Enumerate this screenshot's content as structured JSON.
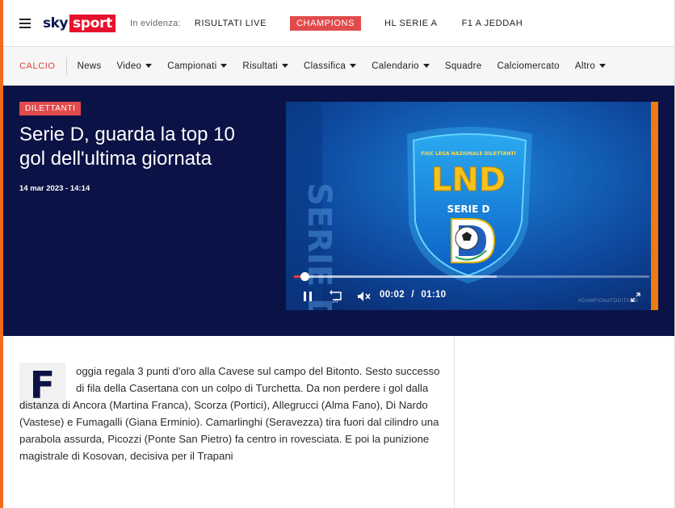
{
  "header": {
    "logo_sky": "sky",
    "logo_sport": "sport",
    "in_evidenza_label": "In evidenza:",
    "links": [
      "RISULTATI LIVE",
      "CHAMPIONS",
      "HL SERIE A",
      "F1 A JEDDAH"
    ]
  },
  "subnav": {
    "section": "CALCIO",
    "items": [
      {
        "label": "News",
        "dropdown": false
      },
      {
        "label": "Video",
        "dropdown": true
      },
      {
        "label": "Campionati",
        "dropdown": true
      },
      {
        "label": "Risultati",
        "dropdown": true
      },
      {
        "label": "Classifica",
        "dropdown": true
      },
      {
        "label": "Calendario",
        "dropdown": true
      },
      {
        "label": "Squadre",
        "dropdown": false
      },
      {
        "label": "Calciomercato",
        "dropdown": false
      },
      {
        "label": "Altro",
        "dropdown": true
      }
    ]
  },
  "hero": {
    "badge": "DILETTANTI",
    "title": "Serie D, guarda la top 10 gol dell'ultima giornata",
    "date": "14 mar 2023 - 14:14"
  },
  "video": {
    "shield_top": "FIGC LEGA NAZIONALE DILETTANTI",
    "logo_lnd": "LND",
    "logo_serie": "SERIE D",
    "side_text": "SERIE D",
    "current_time": "00:02",
    "separator": "/",
    "duration": "01:10",
    "watermark": "#CAMPIONATODITALIA",
    "played_fraction": 0.03,
    "buffered_fraction": 0.57
  },
  "article": {
    "dropcap": "F",
    "text": "oggia regala 3 punti d'oro alla Cavese sul campo del Bitonto. Sesto successo di fila della Casertana con un colpo di Turchetta. Da non perdere i gol dalla distanza di Ancora (Martina Franca), Scorza (Portici), Allegrucci (Alma Fano), Di Nardo (Vastese) e Fumagalli (Giana Erminio). Camarlinghi (Seravezza) tira fuori dal cilindro una parabola assurda, Picozzi (Ponte San Pietro) fa centro in rovesciata. E poi la punizione magistrale di Kosovan, decisiva per il Trapani"
  },
  "colors": {
    "navy": "#0b1245",
    "red": "#e14b4b",
    "orange_accent": "#ee7a12"
  }
}
